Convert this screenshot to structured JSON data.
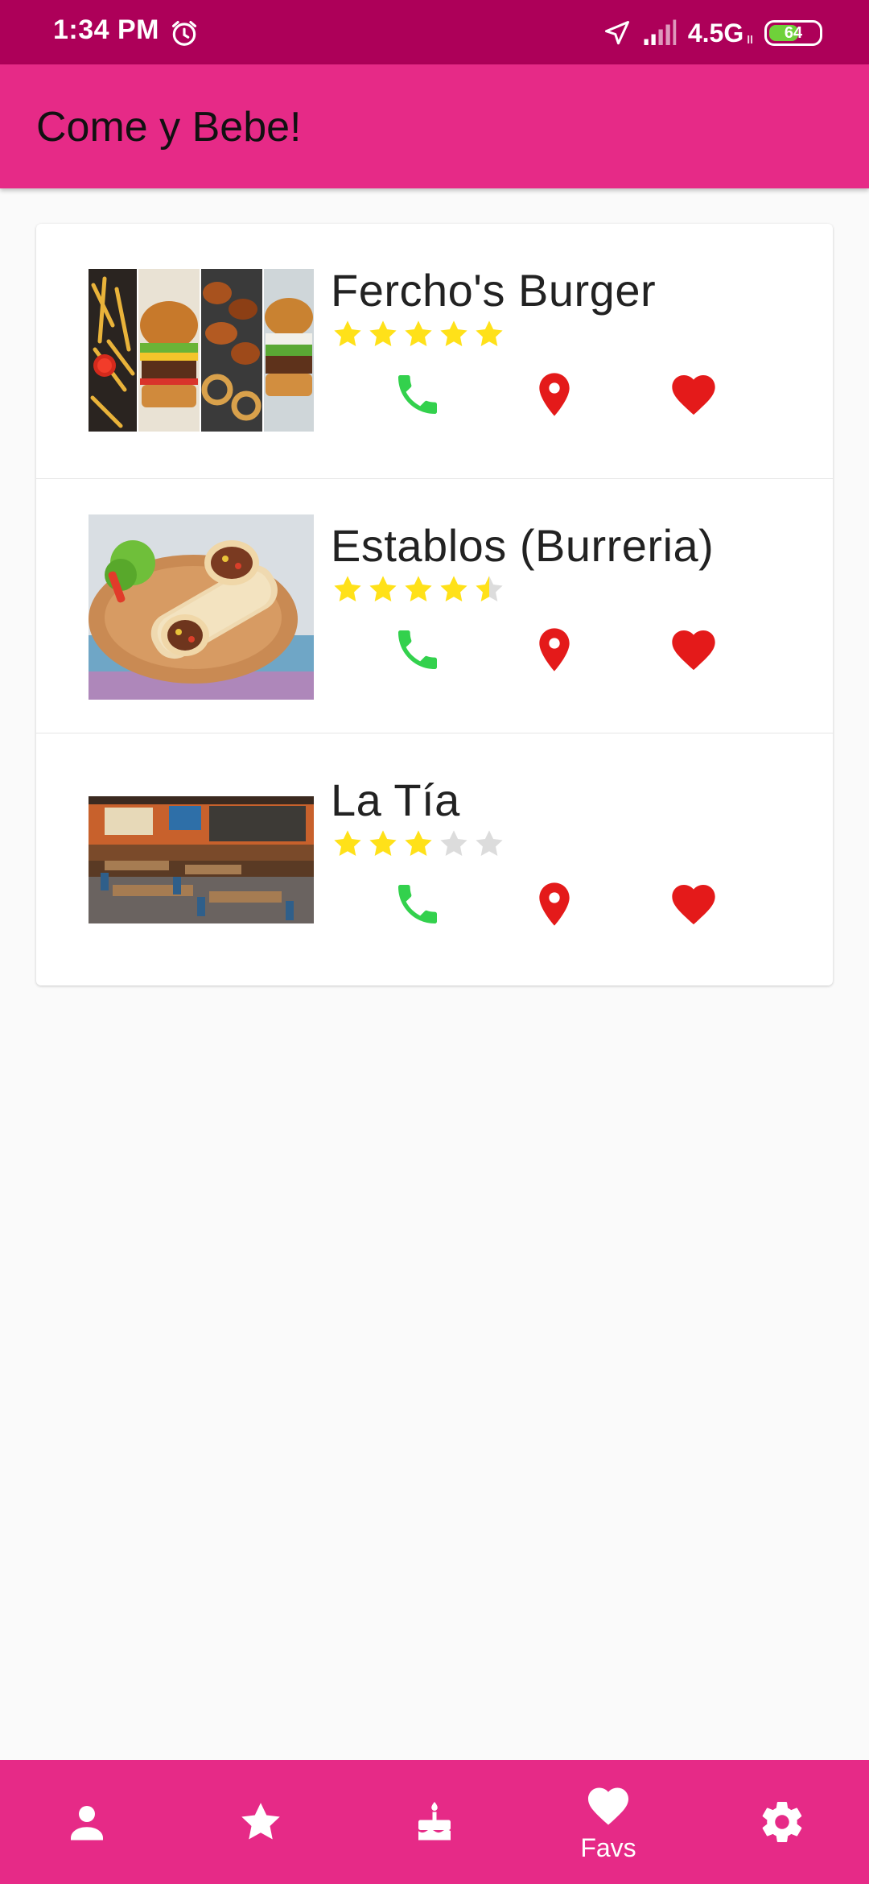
{
  "status_bar": {
    "time": "1:34 PM",
    "network": "4.5G",
    "network_sub": "ll",
    "battery_percent": "64",
    "icons": [
      "alarm-icon",
      "location-arrow-icon",
      "signal-icon",
      "battery-icon"
    ]
  },
  "app_bar": {
    "title": "Come y Bebe!",
    "color": "#e62a87"
  },
  "restaurants": [
    {
      "name": "Fercho's Burger",
      "rating": 5,
      "thumbnail": "burger-collage-image",
      "actions": [
        "phone-icon",
        "location-pin-icon",
        "heart-icon"
      ]
    },
    {
      "name": "Establos (Burreria)",
      "rating": 4.5,
      "thumbnail": "burrito-plate-image",
      "actions": [
        "phone-icon",
        "location-pin-icon",
        "heart-icon"
      ]
    },
    {
      "name": "La Tía",
      "rating": 3,
      "thumbnail": "restaurant-interior-image",
      "actions": [
        "phone-icon",
        "location-pin-icon",
        "heart-icon"
      ]
    }
  ],
  "bottom_nav": {
    "items": [
      {
        "icon": "person-icon",
        "label": ""
      },
      {
        "icon": "star-icon",
        "label": ""
      },
      {
        "icon": "cake-icon",
        "label": ""
      },
      {
        "icon": "heart-icon",
        "label": "Favs",
        "selected": true
      },
      {
        "icon": "gear-icon",
        "label": ""
      }
    ]
  },
  "colors": {
    "status_bar": "#ad0059",
    "accent": "#e62a87",
    "star_on": "#ffe119",
    "star_off": "#dcdcdc",
    "phone": "#33d14d",
    "location": "#e41a1a",
    "favorite": "#e41a1a"
  }
}
